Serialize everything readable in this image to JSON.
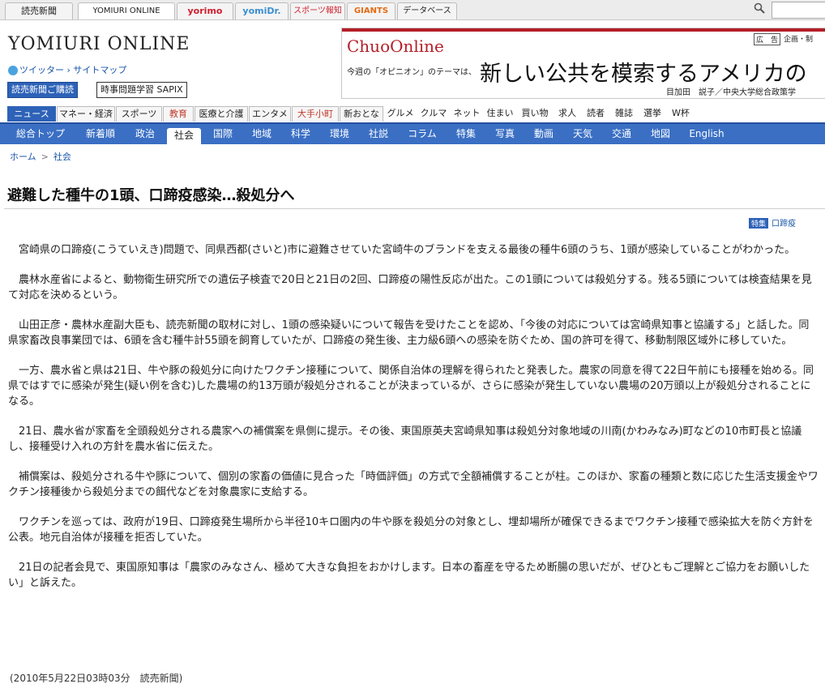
{
  "top_tabs": [
    "読売新聞",
    "YOMIURI ONLINE",
    "yorimo",
    "yomiDr.",
    "スポーツ報知",
    "GIANTS",
    "データベース"
  ],
  "search": {
    "placeholder": ""
  },
  "header": {
    "logo": "YOMIURI ONLINE",
    "twitter": "ツイッター",
    "sitemap": "サイトマップ",
    "promo_subscribe": "読売新聞ご購読",
    "promo_study": "時事問題学習 SAPIX"
  },
  "ad": {
    "brand": "ChuoOnline",
    "label": "広　告",
    "note": "企画・制",
    "lead": "今週の「オピニオン」のテーマは、",
    "headline": "新しい公共を模索するアメリカの",
    "author": "目加田　説子／中央大学総合政策学"
  },
  "categories": [
    "ニュース",
    "マネー・経済",
    "スポーツ",
    "教育",
    "医療と介護",
    "エンタメ",
    "大手小町",
    "新おとな",
    "グルメ",
    "クルマ",
    "ネット",
    "住まい",
    "買い物",
    "求人",
    "読者",
    "雑誌",
    "選挙",
    "W杯"
  ],
  "sections": [
    "総合トップ",
    "新着順",
    "政治",
    "社会",
    "国際",
    "地域",
    "科学",
    "環境",
    "社説",
    "コラム",
    "特集",
    "写真",
    "動画",
    "天気",
    "交通",
    "地図",
    "English"
  ],
  "breadcrumb": {
    "home": "ホーム",
    "sep": ">",
    "current": "社会"
  },
  "article": {
    "title": "避難した種牛の1頭、口蹄疫感染…殺処分へ",
    "feature_tag": "特集",
    "feature_link": "口蹄疫",
    "paragraphs": [
      "宮崎県の口蹄疫(こうていえき)問題で、同県西都(さいと)市に避難させていた宮崎牛のブランドを支える最後の種牛6頭のうち、1頭が感染していることがわかった。",
      "農林水産省によると、動物衛生研究所での遺伝子検査で20日と21日の2回、口蹄疫の陽性反応が出た。この1頭については殺処分する。残る5頭については検査結果を見て対応を決めるという。",
      "山田正彦・農林水産副大臣も、読売新聞の取材に対し、1頭の感染疑いについて報告を受けたことを認め、「今後の対応については宮崎県知事と協議する」と話した。同県家畜改良事業団では、6頭を含む種牛計55頭を飼育していたが、口蹄疫の発生後、主力級6頭への感染を防ぐため、国の許可を得て、移動制限区域外に移していた。",
      "一方、農水省と県は21日、牛や豚の殺処分に向けたワクチン接種について、関係自治体の理解を得られたと発表した。農家の同意を得て22日午前にも接種を始める。同県ではすでに感染が発生(疑い例を含む)した農場の約13万頭が殺処分されることが決まっているが、さらに感染が発生していない農場の20万頭以上が殺処分されることになる。",
      "21日、農水省が家畜を全頭殺処分される農家への補償案を県側に提示。その後、東国原英夫宮崎県知事は殺処分対象地域の川南(かわみなみ)町などの10市町長と協議し、接種受け入れの方針を農水省に伝えた。",
      "補償案は、殺処分される牛や豚について、個別の家畜の価値に見合った「時価評価」の方式で全額補償することが柱。このほか、家畜の種類と数に応じた生活支援金やワクチン接種後から殺処分までの餌代などを対象農家に支給する。",
      "ワクチンを巡っては、政府が19日、口蹄疫発生場所から半径10キロ圏内の牛や豚を殺処分の対象とし、埋却場所が確保できるまでワクチン接種で感染拡大を防ぐ方針を公表。地元自治体が接種を拒否していた。",
      "21日の記者会見で、東国原知事は「農家のみなさん、極めて大きな負担をおかけします。日本の畜産を守るため断腸の思いだが、ぜひともご理解とご協力をお願いしたい」と訴えた。"
    ],
    "dateline": "(2010年5月22日03時03分　読売新聞)"
  },
  "colors": {
    "nav_blue": "#3a6fc4",
    "accent_red": "#b41e28",
    "link_blue": "#1a56a8"
  }
}
